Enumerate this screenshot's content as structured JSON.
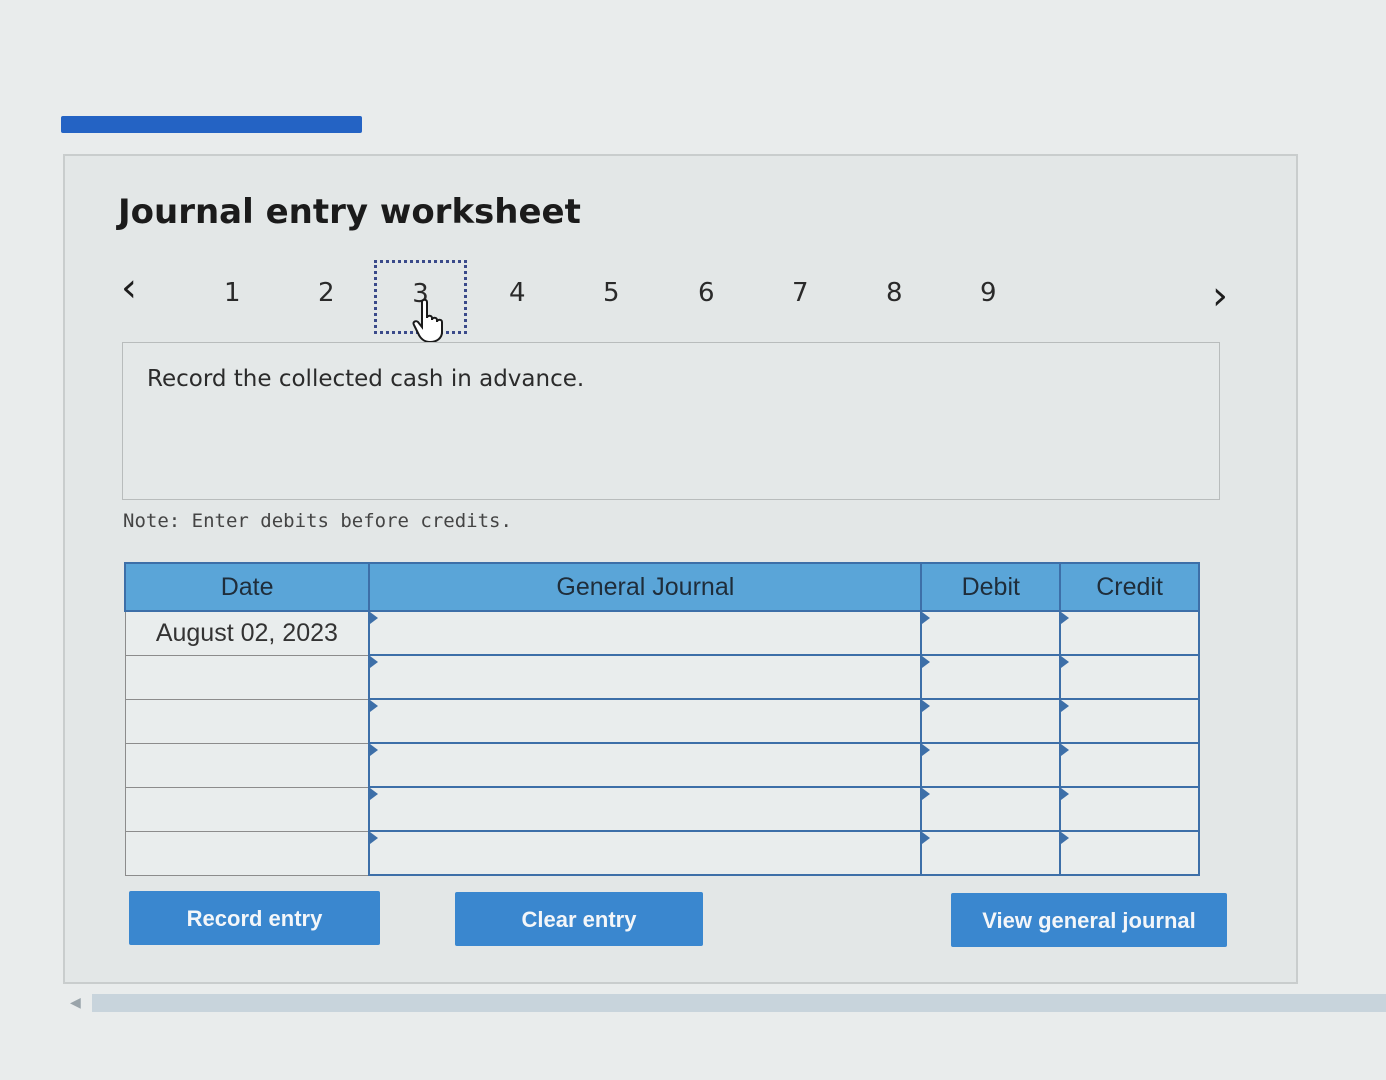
{
  "worksheet": {
    "title": "Journal entry worksheet",
    "steps": [
      "1",
      "2",
      "3",
      "4",
      "5",
      "6",
      "7",
      "8",
      "9"
    ],
    "active_step": "3",
    "instruction": "Record the collected cash in advance.",
    "note": "Note: Enter debits before credits."
  },
  "journal": {
    "headers": {
      "date": "Date",
      "general_journal": "General Journal",
      "debit": "Debit",
      "credit": "Credit"
    },
    "rows": [
      {
        "date": "August 02, 2023",
        "account": "",
        "debit": "",
        "credit": ""
      },
      {
        "date": "",
        "account": "",
        "debit": "",
        "credit": ""
      },
      {
        "date": "",
        "account": "",
        "debit": "",
        "credit": ""
      },
      {
        "date": "",
        "account": "",
        "debit": "",
        "credit": ""
      },
      {
        "date": "",
        "account": "",
        "debit": "",
        "credit": ""
      },
      {
        "date": "",
        "account": "",
        "debit": "",
        "credit": ""
      }
    ]
  },
  "buttons": {
    "record": "Record entry",
    "clear": "Clear entry",
    "view": "View general journal"
  },
  "icons": {
    "prev": "chevron-left-icon",
    "next": "chevron-right-icon",
    "cursor": "hand-pointer-icon"
  },
  "colors": {
    "accent": "#2463c4",
    "header_bg": "#5aa5d8",
    "button_bg": "#3a87cf"
  }
}
